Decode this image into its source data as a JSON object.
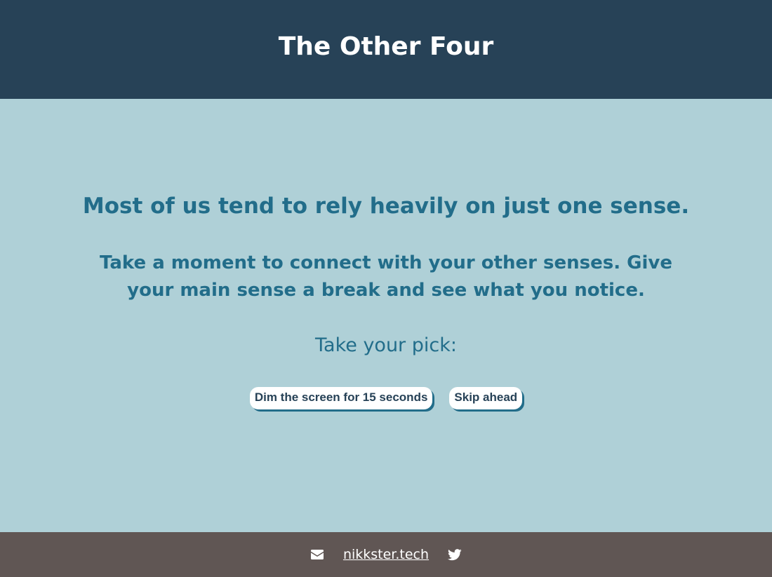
{
  "header": {
    "title": "The Other Four"
  },
  "main": {
    "lead": "Most of us tend to rely heavily on just one sense.",
    "sub": "Take a moment to connect with your other senses. Give your main sense a break and see what you notice.",
    "prompt": "Take your pick:",
    "buttons": {
      "dim_label": "Dim the screen for 15 seconds",
      "skip_label": "Skip ahead"
    }
  },
  "footer": {
    "link_text": "nikkster.tech",
    "icons": [
      "envelope-icon",
      "twitter-icon"
    ]
  },
  "colors": {
    "header_bg": "#274257",
    "main_bg": "#afd0d7",
    "accent": "#226d8a",
    "footer_bg": "#605654"
  }
}
